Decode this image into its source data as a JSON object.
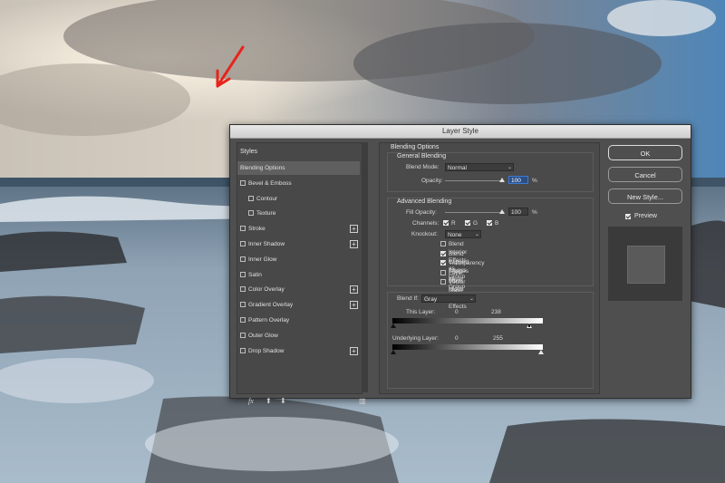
{
  "dialog": {
    "title": "Layer Style",
    "buttons": {
      "ok": "OK",
      "cancel": "Cancel",
      "new_style": "New Style...",
      "preview": "Preview"
    },
    "preview_checked": true
  },
  "styles_panel": {
    "header": "Styles",
    "items": [
      {
        "label": "Blending Options",
        "checkbox": false,
        "indent": false,
        "plus": false,
        "selected": true
      },
      {
        "label": "Bevel & Emboss",
        "checkbox": true,
        "indent": false,
        "plus": false
      },
      {
        "label": "Contour",
        "checkbox": true,
        "indent": true,
        "plus": false
      },
      {
        "label": "Texture",
        "checkbox": true,
        "indent": true,
        "plus": false
      },
      {
        "label": "Stroke",
        "checkbox": true,
        "indent": false,
        "plus": true
      },
      {
        "label": "Inner Shadow",
        "checkbox": true,
        "indent": false,
        "plus": true
      },
      {
        "label": "Inner Glow",
        "checkbox": true,
        "indent": false,
        "plus": false
      },
      {
        "label": "Satin",
        "checkbox": true,
        "indent": false,
        "plus": false
      },
      {
        "label": "Color Overlay",
        "checkbox": true,
        "indent": false,
        "plus": true
      },
      {
        "label": "Gradient Overlay",
        "checkbox": true,
        "indent": false,
        "plus": true
      },
      {
        "label": "Pattern Overlay",
        "checkbox": true,
        "indent": false,
        "plus": false
      },
      {
        "label": "Outer Glow",
        "checkbox": true,
        "indent": false,
        "plus": false
      },
      {
        "label": "Drop Shadow",
        "checkbox": true,
        "indent": false,
        "plus": true
      }
    ],
    "footer_fx": "fx"
  },
  "blending": {
    "section_title": "Blending Options",
    "general_title": "General Blending",
    "blend_mode_label": "Blend Mode:",
    "blend_mode_value": "Normal",
    "opacity_label": "Opacity:",
    "opacity_value": "100",
    "percent": "%",
    "advanced_title": "Advanced Blending",
    "fill_opacity_label": "Fill Opacity:",
    "fill_opacity_value": "100",
    "channels_label": "Channels:",
    "channels": [
      "R",
      "G",
      "B"
    ],
    "knockout_label": "Knockout:",
    "knockout_value": "None",
    "options": [
      {
        "label": "Blend Interior Effects as Group",
        "checked": false
      },
      {
        "label": "Blend Clipped Layers as Group",
        "checked": true
      },
      {
        "label": "Transparency Shapes Layer",
        "checked": true
      },
      {
        "label": "Layer Mask Hides Effects",
        "checked": false
      },
      {
        "label": "Vector Mask Hides Effects",
        "checked": false
      }
    ],
    "blend_if_label": "Blend If:",
    "blend_if_value": "Gray",
    "this_layer_label": "This Layer:",
    "this_layer_low": "0",
    "this_layer_high": "238",
    "underlying_label": "Underlying Layer:",
    "underlying_low": "0",
    "underlying_high": "255"
  },
  "colors": {
    "annotation_arrow": "#e8241c",
    "selected_field": "#2a4f86"
  }
}
